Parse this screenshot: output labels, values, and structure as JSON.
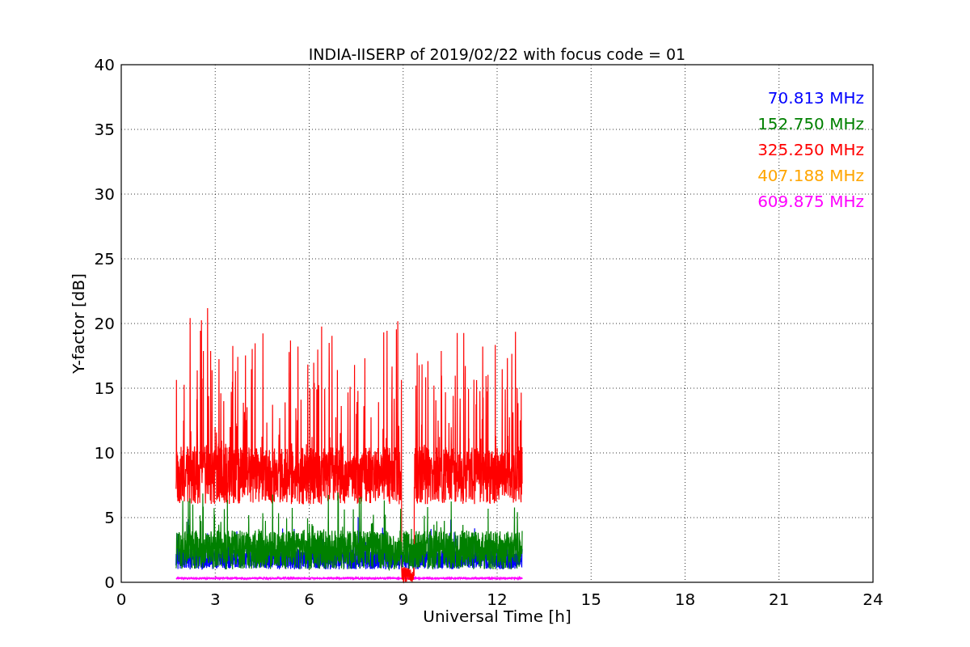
{
  "plot": {
    "title": "INDIA-IISERP of 2019/02/22 with focus code = 01",
    "xlabel": "Universal Time [h]",
    "ylabel": "Y-factor [dB]",
    "xticks": [
      "0",
      "3",
      "6",
      "9",
      "12",
      "15",
      "18",
      "21",
      "24"
    ],
    "yticks": [
      "40",
      "35",
      "30",
      "25",
      "20",
      "15",
      "10",
      "5",
      "0"
    ],
    "legend": [
      {
        "label": "70.813 MHz",
        "color": "#0000ff"
      },
      {
        "label": "152.750 MHz",
        "color": "#008000"
      },
      {
        "label": "325.250 MHz",
        "color": "#ff0000"
      },
      {
        "label": "407.188 MHz",
        "color": "#ffa500"
      },
      {
        "label": "609.875 MHz",
        "color": "#ff00ff"
      }
    ]
  }
}
